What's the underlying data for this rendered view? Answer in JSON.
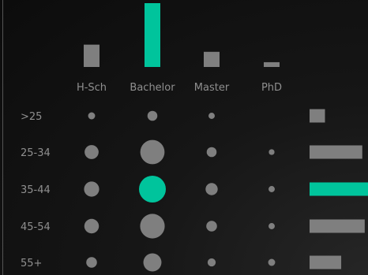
{
  "chart_data": {
    "type": "bubble-matrix",
    "title": "",
    "columns": [
      "H-Sch",
      "Bachelor",
      "Master",
      "PhD"
    ],
    "rows": [
      ">25",
      "25-34",
      "35-44",
      "45-54",
      "55+"
    ],
    "column_totals": [
      28,
      80,
      19,
      6
    ],
    "row_totals": [
      19,
      65,
      74,
      68,
      39
    ],
    "values": [
      [
        1.5,
        3,
        1.2,
        0
      ],
      [
        6,
        18,
        3,
        1
      ],
      [
        7,
        22,
        4.5,
        1.2
      ],
      [
        6.5,
        18.5,
        3.5,
        1.2
      ],
      [
        3.5,
        10,
        2,
        1.5
      ]
    ],
    "highlight": {
      "column": "Bachelor",
      "row": "35-44"
    },
    "colors": {
      "highlight": "#00c49c",
      "base": "#7f7f7f",
      "label": "#8f8f8f"
    }
  }
}
